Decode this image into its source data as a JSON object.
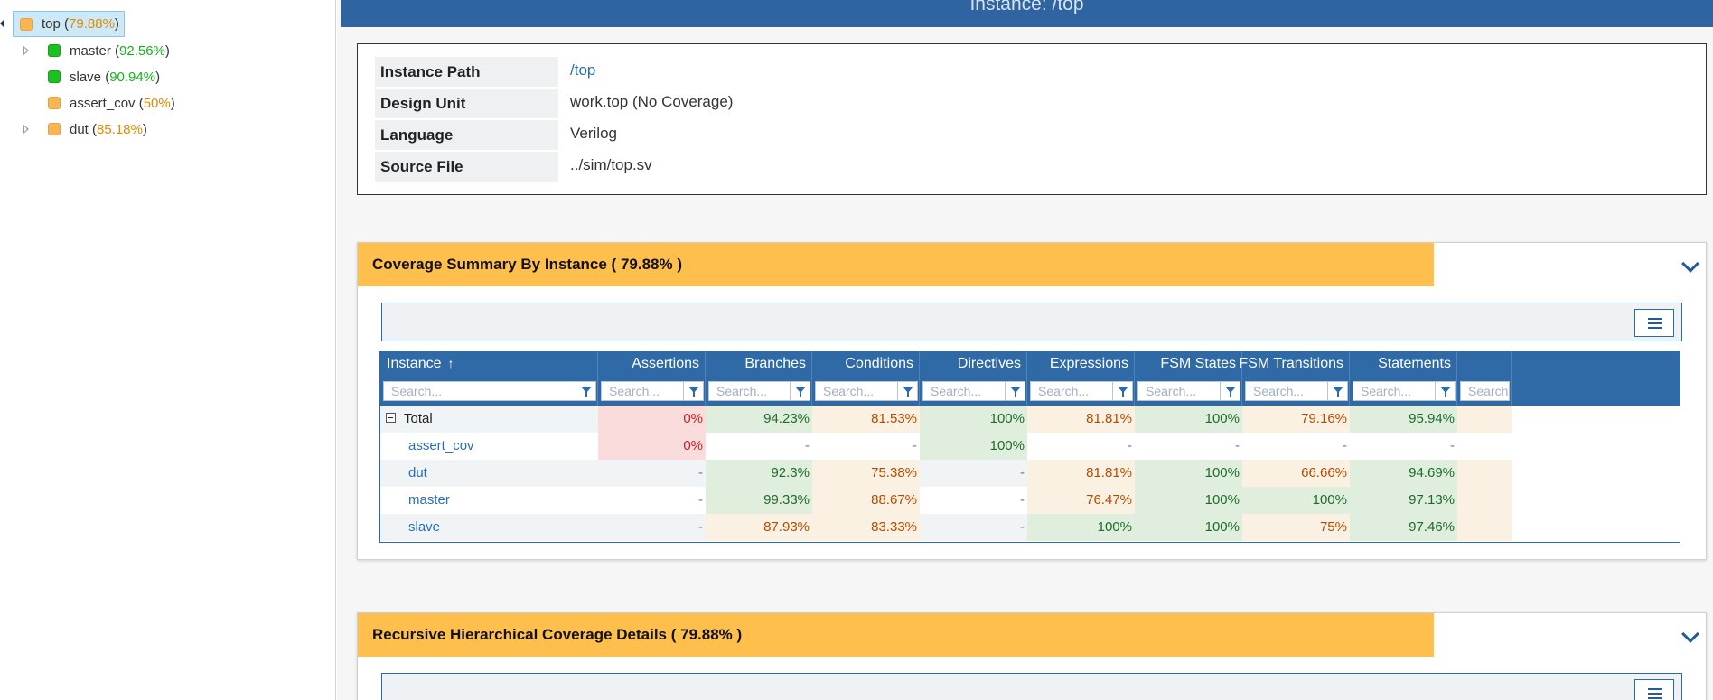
{
  "tree": {
    "root": {
      "name": "top",
      "pct": "79.88%"
    },
    "children": [
      {
        "name": "master",
        "pct": "92.56%",
        "status": "green",
        "expandable": true
      },
      {
        "name": "slave",
        "pct": "90.94%",
        "status": "green",
        "expandable": false
      },
      {
        "name": "assert_cov",
        "pct": "50%",
        "status": "orange",
        "expandable": false
      },
      {
        "name": "dut",
        "pct": "85.18%",
        "status": "orange",
        "expandable": true
      }
    ]
  },
  "header": {
    "title": "Instance: /top"
  },
  "info": {
    "rows": [
      {
        "label": "Instance Path",
        "value": "/top"
      },
      {
        "label": "Design Unit",
        "value": "work.top (No Coverage)"
      },
      {
        "label": "Language",
        "value": "Verilog"
      },
      {
        "label": "Source File",
        "value": "../sim/top.sv"
      }
    ]
  },
  "summary_panel": {
    "title": "Coverage Summary By Instance ( 79.88% )"
  },
  "details_panel": {
    "title": "Recursive Hierarchical Coverage Details ( 79.88% )"
  },
  "grid": {
    "filter_placeholder": "Search...",
    "columns": [
      "Instance",
      "Assertions",
      "Branches",
      "Conditions",
      "Directives",
      "Expressions",
      "FSM States",
      "FSM Transitions",
      "Statements",
      ""
    ],
    "rows": [
      {
        "instance": "Total",
        "cells": [
          "0%",
          "94.23%",
          "81.53%",
          "100%",
          "81.81%",
          "100%",
          "79.16%",
          "95.94%",
          ""
        ]
      },
      {
        "instance": "assert_cov",
        "cells": [
          "0%",
          "-",
          "-",
          "100%",
          "-",
          "-",
          "-",
          "-",
          ""
        ]
      },
      {
        "instance": "dut",
        "cells": [
          "-",
          "92.3%",
          "75.38%",
          "-",
          "81.81%",
          "100%",
          "66.66%",
          "94.69%",
          ""
        ]
      },
      {
        "instance": "master",
        "cells": [
          "-",
          "99.33%",
          "88.67%",
          "-",
          "76.47%",
          "100%",
          "100%",
          "97.13%",
          ""
        ]
      },
      {
        "instance": "slave",
        "cells": [
          "-",
          "87.93%",
          "83.33%",
          "-",
          "100%",
          "100%",
          "75%",
          "97.46%",
          ""
        ]
      }
    ]
  },
  "colors": {
    "title_bar": "#2f64a0",
    "panel_header": "#ffbf4d",
    "cell_red": "#fbdcdc",
    "cell_green": "#dfeedd",
    "cell_amber": "#fbf1e3"
  }
}
